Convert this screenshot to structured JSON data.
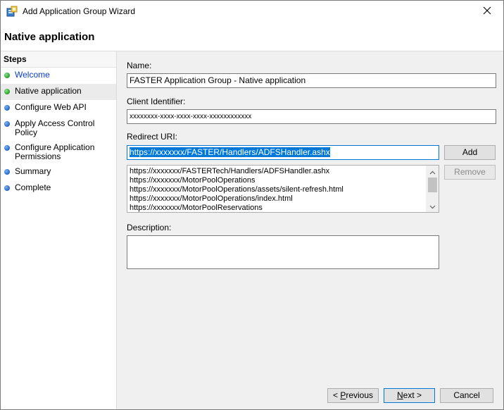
{
  "window": {
    "title": "Add Application Group Wizard"
  },
  "header": {
    "page_title": "Native application"
  },
  "steps": {
    "heading": "Steps",
    "items": [
      {
        "label": "Welcome",
        "state": "done",
        "link": true
      },
      {
        "label": "Native application",
        "state": "done",
        "link": false,
        "active": true
      },
      {
        "label": "Configure Web API",
        "state": "pending",
        "link": false
      },
      {
        "label": "Apply Access Control Policy",
        "state": "pending",
        "link": false
      },
      {
        "label": "Configure Application Permissions",
        "state": "pending",
        "link": false
      },
      {
        "label": "Summary",
        "state": "pending",
        "link": false
      },
      {
        "label": "Complete",
        "state": "pending",
        "link": false
      }
    ]
  },
  "form": {
    "name_label": "Name:",
    "name_value": "FASTER Application Group - Native application",
    "client_id_label": "Client Identifier:",
    "client_id_value": "xxxxxxxx-xxxx-xxxx-xxxx-xxxxxxxxxxxx",
    "redirect_label": "Redirect URI:",
    "redirect_value": "https://xxxxxxx/FASTER/Handlers/ADFSHandler.ashx",
    "add_label": "Add",
    "remove_label": "Remove",
    "redirect_list": [
      "https://xxxxxxx/FASTERTech/Handlers/ADFSHandler.ashx",
      "https://xxxxxxx/MotorPoolOperations",
      "https://xxxxxxx/MotorPoolOperations/assets/silent-refresh.html",
      "https://xxxxxxx/MotorPoolOperations/index.html",
      "https://xxxxxxx/MotorPoolReservations"
    ],
    "description_label": "Description:",
    "description_value": ""
  },
  "footer": {
    "previous_prefix": "< ",
    "previous_key": "P",
    "previous_rest": "revious",
    "next_key": "N",
    "next_rest": "ext >",
    "cancel_label": "Cancel"
  },
  "colors": {
    "accent": "#0078d7",
    "step_done": "#22a022",
    "step_pending": "#1f64c8",
    "link": "#0a3ec8"
  }
}
